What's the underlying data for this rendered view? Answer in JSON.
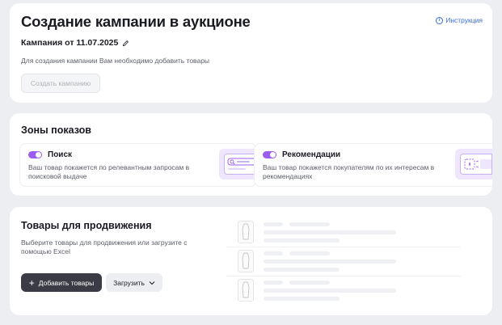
{
  "campaign": {
    "title": "Создание кампании в аукционе",
    "instruction_label": "Инструкция",
    "campaign_name": "Кампания от 11.07.2025",
    "hint": "Для создания кампании Вам необходимо добавить товары",
    "create_button": "Создать кампанию"
  },
  "zones": {
    "title": "Зоны показов",
    "items": [
      {
        "name": "Поиск",
        "description": "Ваш товар покажется по релевантным запросам в поисковой выдаче",
        "enabled": true
      },
      {
        "name": "Рекомендации",
        "description": "Ваш товар покажется покупателям по их интересам в рекомендациях",
        "enabled": true
      }
    ]
  },
  "products": {
    "title": "Товары для продвижения",
    "description": "Выберите товары для продвижения или загрузите с помощью Excel",
    "add_button": "Добавить товары",
    "upload_button": "Загрузить"
  },
  "colors": {
    "accent": "#9b5cf0",
    "link": "#3b6dd9",
    "dark_button": "#3a3b44"
  },
  "icons": {
    "instruction": "info-icon",
    "edit": "pencil-icon",
    "add": "plus-icon",
    "dropdown": "chevron-down-icon"
  }
}
